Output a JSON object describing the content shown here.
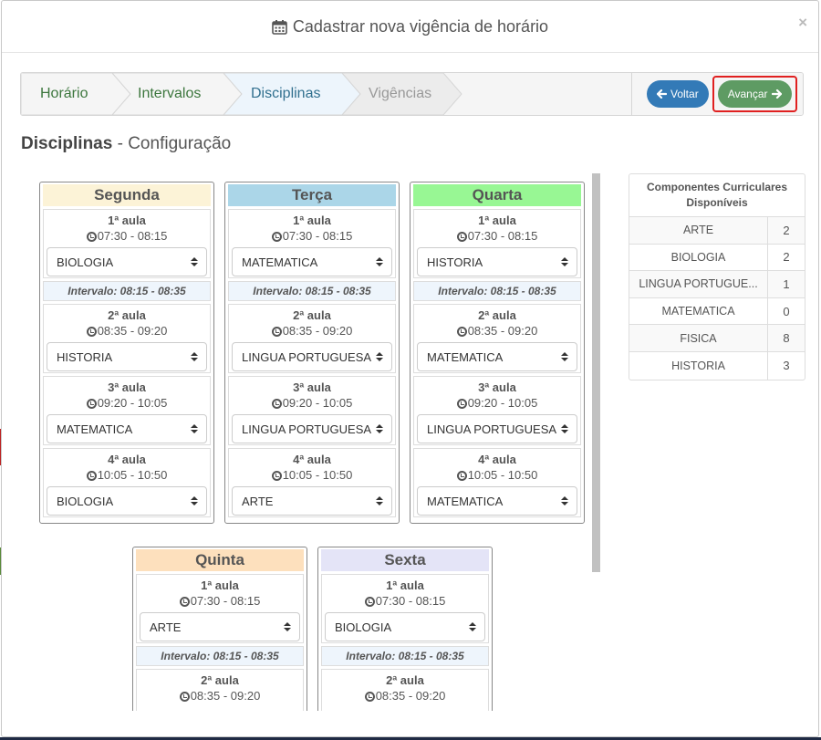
{
  "modal": {
    "title": "Cadastrar nova vigência de horário",
    "title_icon": "calendar-icon",
    "close_label": "×"
  },
  "wizard": {
    "steps": [
      {
        "label": "Horário",
        "state": "done",
        "color": "#3c763d"
      },
      {
        "label": "Intervalos",
        "state": "done",
        "color": "#3c763d"
      },
      {
        "label": "Disciplinas",
        "state": "active",
        "color": "#31708f"
      },
      {
        "label": "Vigências",
        "state": "pending",
        "color": "#999999"
      }
    ],
    "voltar_label": "Voltar",
    "avancar_label": "Avançar"
  },
  "heading": {
    "bold": "Disciplinas",
    "rest": " - Configuração"
  },
  "intervalo_label": "Intervalo: 08:15 - 08:35",
  "days": [
    {
      "name": "Segunda",
      "color": "#fcf3d7",
      "aulas": [
        {
          "num": "1ª aula",
          "time": "07:30 - 08:15",
          "subject": "BIOLOGIA"
        },
        {
          "num": "2ª aula",
          "time": "08:35 - 09:20",
          "subject": "HISTORIA"
        },
        {
          "num": "3ª aula",
          "time": "09:20 - 10:05",
          "subject": "MATEMATICA"
        },
        {
          "num": "4ª aula",
          "time": "10:05 - 10:50",
          "subject": "BIOLOGIA"
        }
      ]
    },
    {
      "name": "Terça",
      "color": "#abd6e8",
      "aulas": [
        {
          "num": "1ª aula",
          "time": "07:30 - 08:15",
          "subject": "MATEMATICA"
        },
        {
          "num": "2ª aula",
          "time": "08:35 - 09:20",
          "subject": "LINGUA PORTUGUESA"
        },
        {
          "num": "3ª aula",
          "time": "09:20 - 10:05",
          "subject": "LINGUA PORTUGUESA"
        },
        {
          "num": "4ª aula",
          "time": "10:05 - 10:50",
          "subject": "ARTE"
        }
      ]
    },
    {
      "name": "Quarta",
      "color": "#98f794",
      "aulas": [
        {
          "num": "1ª aula",
          "time": "07:30 - 08:15",
          "subject": "HISTORIA"
        },
        {
          "num": "2ª aula",
          "time": "08:35 - 09:20",
          "subject": "MATEMATICA"
        },
        {
          "num": "3ª aula",
          "time": "09:20 - 10:05",
          "subject": "LINGUA PORTUGUESA"
        },
        {
          "num": "4ª aula",
          "time": "10:05 - 10:50",
          "subject": "MATEMATICA"
        }
      ]
    },
    {
      "name": "Quinta",
      "color": "#fde0bd",
      "aulas": [
        {
          "num": "1ª aula",
          "time": "07:30 - 08:15",
          "subject": "ARTE"
        },
        {
          "num": "2ª aula",
          "time": "08:35 - 09:20",
          "subject": ""
        }
      ]
    },
    {
      "name": "Sexta",
      "color": "#e4e4f7",
      "aulas": [
        {
          "num": "1ª aula",
          "time": "07:30 - 08:15",
          "subject": "BIOLOGIA"
        },
        {
          "num": "2ª aula",
          "time": "08:35 - 09:20",
          "subject": ""
        }
      ]
    }
  ],
  "componentes": {
    "title": "Componentes Curriculares Disponíveis",
    "rows": [
      {
        "name": "ARTE",
        "count": "2"
      },
      {
        "name": "BIOLOGIA",
        "count": "2"
      },
      {
        "name": "LINGUA PORTUGUE...",
        "count": "1"
      },
      {
        "name": "MATEMATICA",
        "count": "0"
      },
      {
        "name": "FISICA",
        "count": "8"
      },
      {
        "name": "HISTORIA",
        "count": "3"
      }
    ]
  }
}
